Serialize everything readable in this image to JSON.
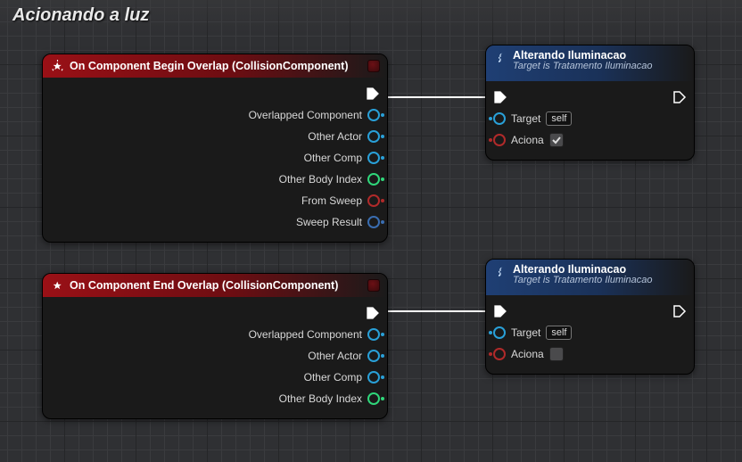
{
  "header": {
    "title": "Acionando a luz"
  },
  "nodes": {
    "begin": {
      "title": "On Component Begin Overlap (CollisionComponent)",
      "pins": {
        "overlapped": "Overlapped Component",
        "other_actor": "Other Actor",
        "other_comp": "Other Comp",
        "body_index": "Other Body Index",
        "from_sweep": "From Sweep",
        "sweep_result": "Sweep Result"
      }
    },
    "end": {
      "title": "On Component End Overlap (CollisionComponent)",
      "pins": {
        "overlapped": "Overlapped Component",
        "other_actor": "Other Actor",
        "other_comp": "Other Comp",
        "body_index": "Other Body Index"
      }
    },
    "alt1": {
      "title": "Alterando Iluminacao",
      "subtitle": "Target is Tratamento Iluminacao",
      "target_label": "Target",
      "target_value": "self",
      "aciona_label": "Aciona",
      "aciona_checked": true
    },
    "alt2": {
      "title": "Alterando Iluminacao",
      "subtitle": "Target is Tratamento Iluminacao",
      "target_label": "Target",
      "target_value": "self",
      "aciona_label": "Aciona",
      "aciona_checked": false
    }
  }
}
